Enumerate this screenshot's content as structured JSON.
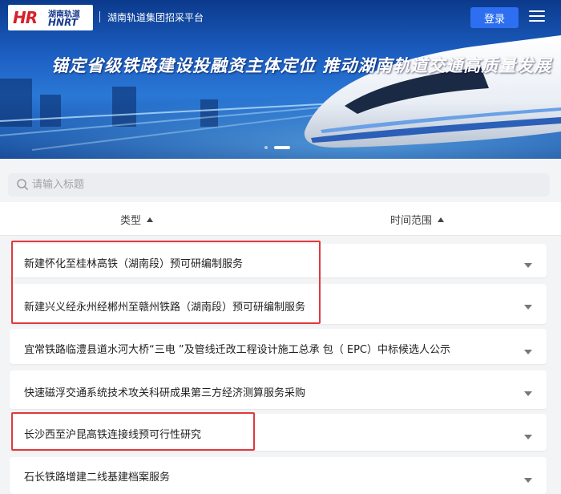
{
  "header": {
    "logo_mark": "HR",
    "logo_cn": "湖南轨道",
    "logo_en": "HNRT",
    "platform_name": "湖南轨道集团招采平台",
    "login_label": "登录"
  },
  "banner": {
    "slogan": "锚定省级铁路建设投融资主体定位    推动湖南轨道交通高质量发展",
    "active_slide": 2,
    "slide_count": 2
  },
  "search": {
    "placeholder": "请输入标题",
    "value": ""
  },
  "filters": {
    "type_label": "类型",
    "time_label": "时间范围"
  },
  "list": [
    {
      "title": "新建怀化至桂林高铁（湖南段）预可研编制服务"
    },
    {
      "title": "新建兴义经永州经郴州至赣州铁路（湖南段）预可研编制服务"
    },
    {
      "title": "宜常铁路临澧县道水河大桥“三电 ”及管线迁改工程设计施工总承 包（ EPC）中标候选人公示"
    },
    {
      "title": "快速磁浮交通系统技术攻关科研成果第三方经济测算服务采购"
    },
    {
      "title": "长沙西至沪昆高铁连接线预可行性研究"
    },
    {
      "title": "石长铁路增建二线基建档案服务"
    }
  ],
  "colors": {
    "accent": "#2d6ff0",
    "brand_red": "#d7202a",
    "highlight": "#e0393e"
  }
}
